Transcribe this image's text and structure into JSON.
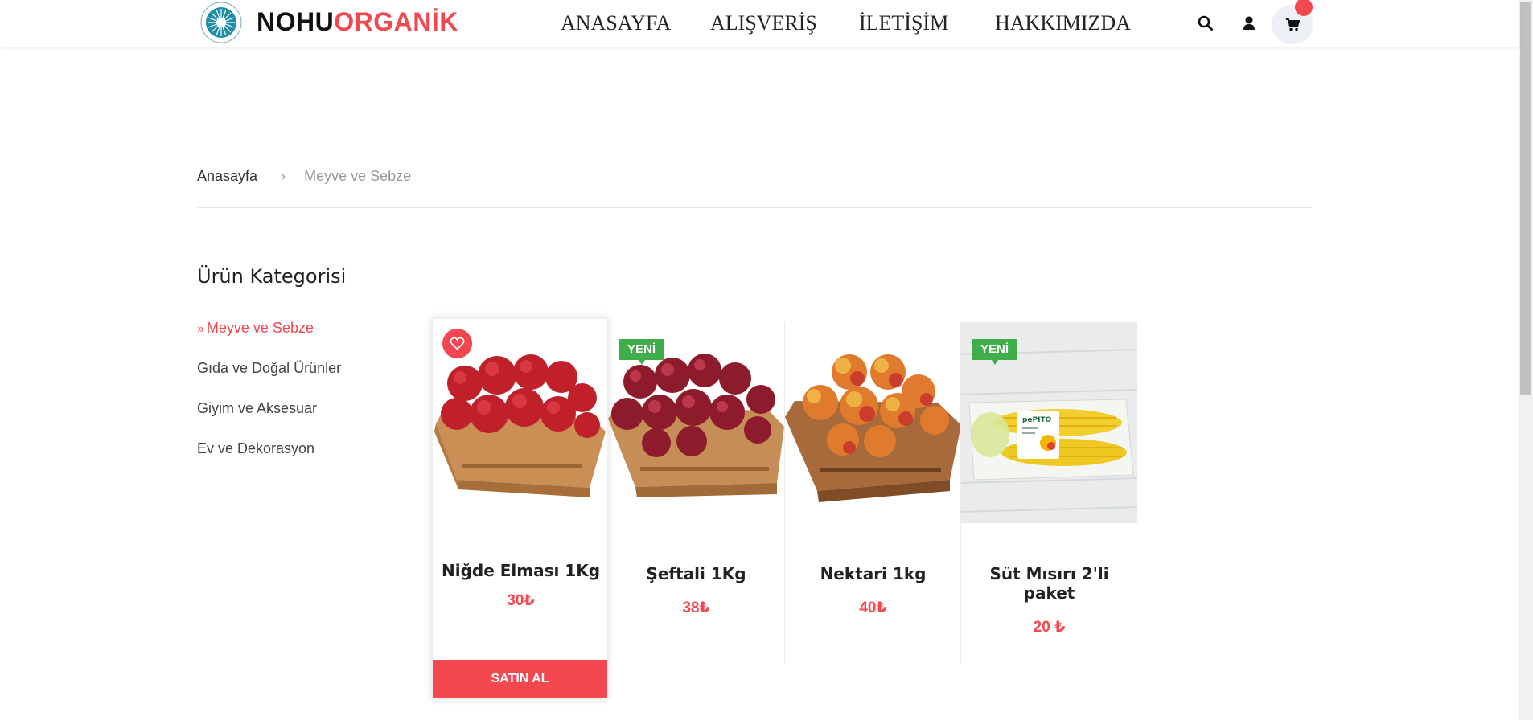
{
  "header": {
    "logo_part1": "NOHU",
    "logo_part2": "ORGANİK",
    "nav": [
      "ANASAYFA",
      "ALIŞVERİŞ",
      "İLETİŞİM",
      "HAKKIMIZDA"
    ],
    "icons": [
      "search-icon",
      "user-icon",
      "cart-icon"
    ]
  },
  "breadcrumb": {
    "home": "Anasayfa",
    "separator": "›",
    "current": "Meyve ve Sebze"
  },
  "sidebar": {
    "title": "Ürün Kategorisi",
    "active_marker": "»",
    "items": [
      "Meyve ve Sebze",
      "Gıda ve Doğal Ürünler",
      "Giyim ve Aksesuar",
      "Ev ve Dekorasyon"
    ]
  },
  "products": [
    {
      "name": "Niğde Elması 1Kg",
      "price": "30₺",
      "badge": "",
      "image": "apples-in-crate"
    },
    {
      "name": "Şeftali 1Kg",
      "price": "38₺",
      "badge": "YENİ",
      "image": "peaches-in-crate"
    },
    {
      "name": "Nektari 1kg",
      "price": "40₺",
      "badge": "",
      "image": "nectarines-in-crate"
    },
    {
      "name": "Süt Mısırı 2'li paket",
      "price": "20 ₺",
      "badge": "YENİ",
      "image": "packaged-corn"
    }
  ],
  "buy_button": "SATIN AL",
  "colors": {
    "accent": "#f4474f",
    "badge_green": "#3fae4a",
    "text": "#222222"
  }
}
